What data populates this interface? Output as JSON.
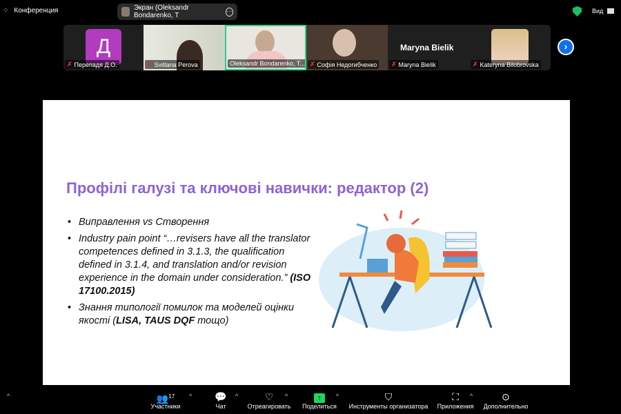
{
  "topbar": {
    "meeting_label": "Конференция",
    "screen_share": "Экран (Oleksandr Bondarenko, T",
    "view_label": "Вид"
  },
  "participants_strip": [
    {
      "initial": "Д",
      "name": "Перепадя Д.О.",
      "tile_color": "#b23bbf"
    },
    {
      "name": "Svitlana Perova"
    },
    {
      "name": "Oleksandr Bondarenko, T...",
      "active": true
    },
    {
      "name": "Софія Недогибченко"
    },
    {
      "display_name": "Maryna Bielik",
      "name": "Maryna Bielik"
    },
    {
      "name": "Kateryna Bilobrovska"
    }
  ],
  "slide": {
    "title": "Профілі галузі та ключові навички: редактор (2)",
    "bullets": [
      {
        "text": "Виправлення vs Створення"
      },
      {
        "text": "Industry pain point “…revisers have all the translator competences defined in 3.1.3, the qualification defined in 3.1.4, and translation and/or revision experience in the domain under consideration.” ",
        "bold": "(ISO 17100.2015)"
      },
      {
        "text": "Знання типології помилок та моделей оцінки якості  (",
        "bold": "LISA, TAUS DQF",
        "tail": " тощо)"
      }
    ]
  },
  "toolbar": {
    "participants_count": "17",
    "items": [
      "Участники",
      "Чат",
      "Отреагировать",
      "Поделиться",
      "Инструменты организатора",
      "Приложения",
      "Дополнительно"
    ]
  },
  "colors": {
    "accent_green": "#19c160",
    "title_purple": "#8c63d6",
    "share_green": "#1ed760"
  }
}
